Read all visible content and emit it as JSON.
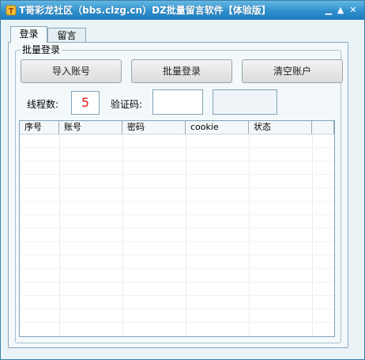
{
  "window": {
    "title": "T哥彩龙社区（bbs.clzg.cn）DZ批量留言软件【体验版】",
    "controls": [
      "▁",
      "▲",
      "✕"
    ]
  },
  "tabs": [
    {
      "label": "登录",
      "active": true
    },
    {
      "label": "留言",
      "active": false
    }
  ],
  "group": {
    "title": "批量登录"
  },
  "buttons": {
    "import": "导入账号",
    "login": "批量登录",
    "clear": "清空账户"
  },
  "form": {
    "threads_label": "线程数:",
    "threads_value": "5",
    "captcha_label": "验证码:",
    "captcha_value": ""
  },
  "table": {
    "columns": [
      "序号",
      "账号",
      "密码",
      "cookie",
      "状态"
    ],
    "rows": []
  },
  "colors": {
    "titlebar": "#2f8fcd",
    "threads_value": "#e02020"
  }
}
